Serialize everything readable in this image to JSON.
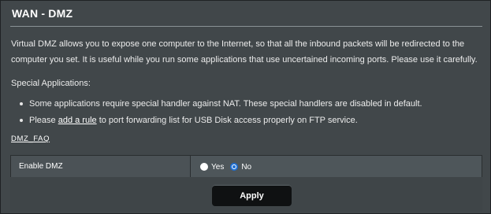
{
  "page": {
    "title": "WAN - DMZ",
    "description": "Virtual DMZ allows you to expose one computer to the Internet, so that all the inbound packets will be redirected to the computer you set. It is useful while you run some applications that use uncertained incoming ports. Please use it carefully.",
    "special_heading": "Special Applications:",
    "bullets": {
      "first": "Some applications require special handler against NAT. These special handlers are disabled in default.",
      "second_prefix": "Please ",
      "second_link": "add a rule",
      "second_suffix": " to port forwarding list for USB Disk access properly on FTP service."
    },
    "faq_link": "DMZ_FAQ"
  },
  "settings": {
    "enable_dmz_label": "Enable DMZ",
    "options": [
      "Yes",
      "No"
    ],
    "selected": "No"
  },
  "actions": {
    "apply_label": "Apply"
  },
  "colors": {
    "radio_selected": "#1f6fd2",
    "panel": "#41474a"
  }
}
